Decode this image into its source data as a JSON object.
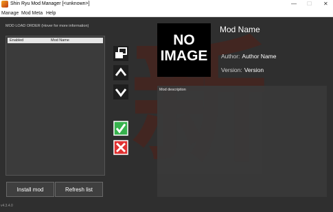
{
  "window": {
    "title": "Shin Ryu Mod Manager [<unknown>]",
    "minimize_glyph": "—",
    "maximize_glyph": "☐",
    "close_glyph": "✕"
  },
  "menu": [
    "Manage",
    "Mod Meta",
    "Help"
  ],
  "mod_list": {
    "section_label": "MOD LOAD ORDER (Hover for more information)",
    "columns": [
      "Enabled",
      "Mod Name"
    ],
    "rows": []
  },
  "side_buttons": {
    "order_icon": "reorder-windows-icon",
    "up_icon": "arrow-up-icon",
    "down_icon": "arrow-down-icon",
    "enable_icon": "checkmark-icon",
    "disable_icon": "x-mark-icon"
  },
  "buttons": {
    "install": "Install mod",
    "refresh": "Refresh list"
  },
  "version": "v4.3.4.0",
  "details": {
    "image_line1": "NO",
    "image_line2": "IMAGE",
    "mod_name": "Mod Name",
    "author_label": "Author:",
    "author_value": "Author Name",
    "version_label": "Version:",
    "version_value": "Version",
    "description_label": "Mod description"
  },
  "colors": {
    "background": "#2f2f2f",
    "check_green": "#37b24d",
    "x_red": "#e03131",
    "watermark": "#5a1c12"
  }
}
